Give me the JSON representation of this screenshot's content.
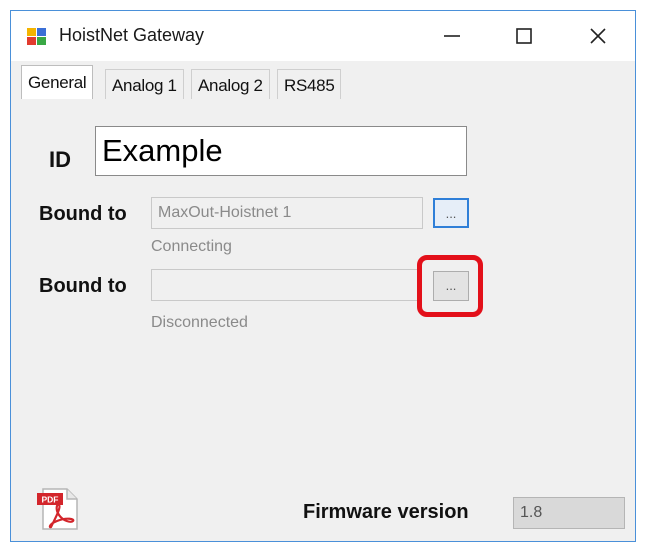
{
  "window": {
    "title": "HoistNet Gateway",
    "icon": "app-icon"
  },
  "titlebar_controls": {
    "minimize": "minimize-icon",
    "maximize": "maximize-icon",
    "close": "close-icon"
  },
  "tabs": [
    {
      "label": "General",
      "active": true
    },
    {
      "label": "Analog 1",
      "active": false
    },
    {
      "label": "Analog 2",
      "active": false
    },
    {
      "label": "RS485",
      "active": false
    }
  ],
  "general": {
    "id_label": "ID",
    "id_value": "Example",
    "bound1": {
      "label": "Bound to",
      "value": "MaxOut-Hoistnet 1",
      "browse_label": "...",
      "status": "Connecting"
    },
    "bound2": {
      "label": "Bound to",
      "value": "",
      "browse_label": "...",
      "status": "Disconnected"
    },
    "firmware_label": "Firmware version",
    "firmware_value": "1.8"
  },
  "colors": {
    "highlight": "#e3101a",
    "focus_border": "#2f7fd8",
    "window_border": "#4a90d9"
  }
}
